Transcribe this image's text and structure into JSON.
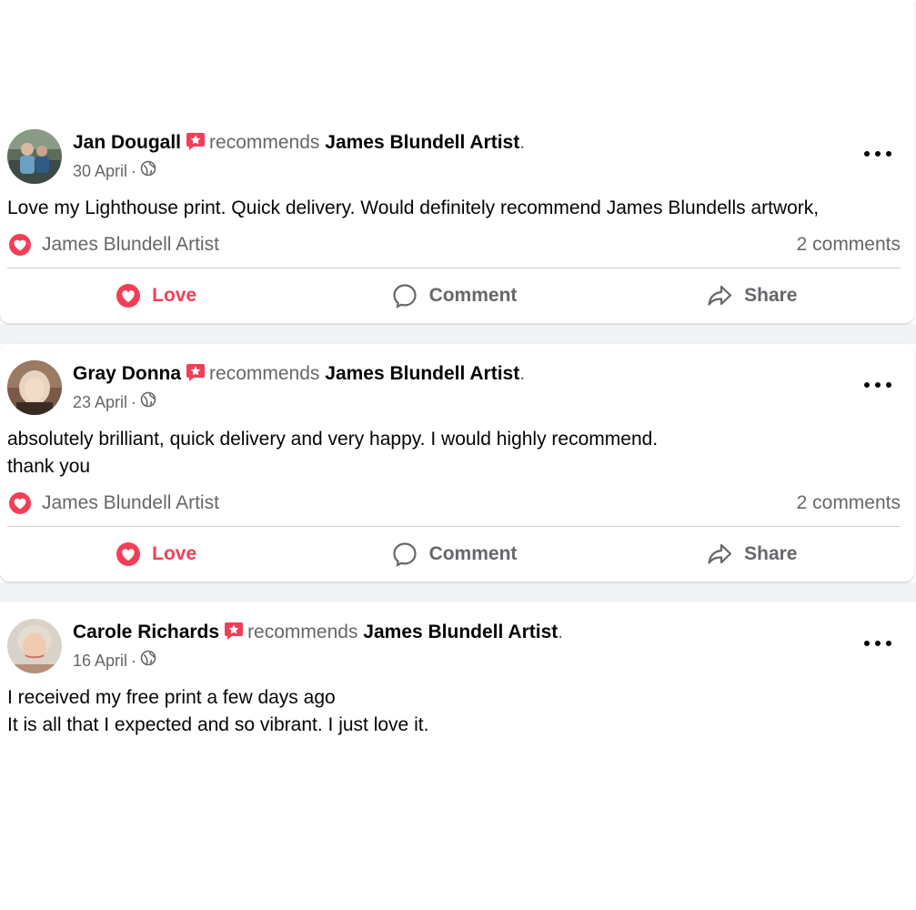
{
  "posts": [
    {
      "author": "Jan Dougall",
      "verb": "recommends",
      "page": "James Blundell Artist",
      "period": ".",
      "date": "30 April",
      "separator": "·",
      "text": "Love my Lighthouse print. Quick delivery.  Would definitely recommend James Blundells artwork,",
      "reactor": "James Blundell Artist",
      "comments": "2 comments",
      "actions": {
        "love": "Love",
        "comment": "Comment",
        "share": "Share"
      }
    },
    {
      "author": "Gray Donna",
      "verb": "recommends",
      "page": "James Blundell Artist",
      "period": ".",
      "date": "23 April",
      "separator": "·",
      "text": "absolutely brilliant,  quick delivery and very happy.  I would highly recommend.\nthank you",
      "reactor": "James Blundell Artist",
      "comments": "2 comments",
      "actions": {
        "love": "Love",
        "comment": "Comment",
        "share": "Share"
      }
    },
    {
      "author": "Carole Richards",
      "verb": "recommends",
      "page": "James Blundell Artist",
      "period": ".",
      "date": "16 April",
      "separator": "·",
      "text": "I received my free print a few days ago\n It is all that I expected and so vibrant. I just love it."
    }
  ],
  "icons": {
    "recommend_badge": "recommend-star-icon",
    "privacy": "globe-icon",
    "more": "more-options-icon",
    "love": "love-heart-icon",
    "comment": "comment-bubble-icon",
    "share": "share-arrow-icon"
  },
  "colors": {
    "love": "#f33e58",
    "muted": "#65676b",
    "text": "#050505",
    "feed_background": "#f0f2f5"
  }
}
